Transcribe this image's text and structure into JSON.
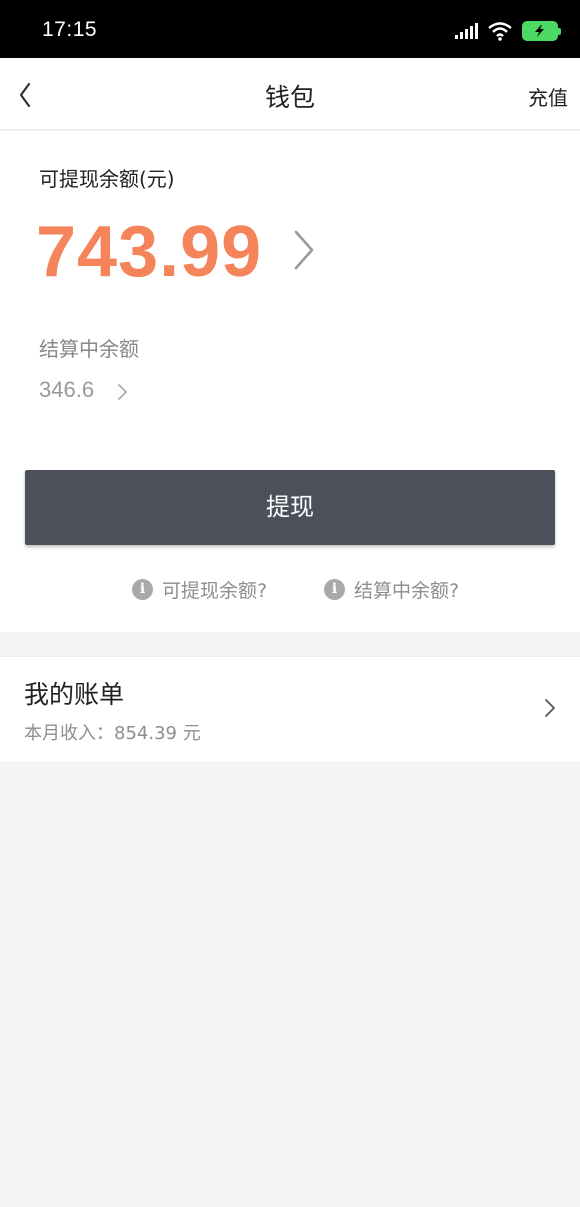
{
  "status_bar": {
    "time": "17:15"
  },
  "nav": {
    "title": "钱包",
    "recharge_label": "充值"
  },
  "balance": {
    "available_label": "可提现余额(元)",
    "available_amount": "743.99",
    "settling_label": "结算中余额",
    "settling_amount": "346.6"
  },
  "actions": {
    "withdraw_label": "提现"
  },
  "help": {
    "available_help": "可提现余额?",
    "settling_help": "结算中余额?"
  },
  "bill": {
    "title": "我的账单",
    "monthly_income": "本月收入：854.39 元"
  },
  "colors": {
    "accent": "#f6845a",
    "button_bg": "#4b505a",
    "battery": "#4cd964"
  }
}
